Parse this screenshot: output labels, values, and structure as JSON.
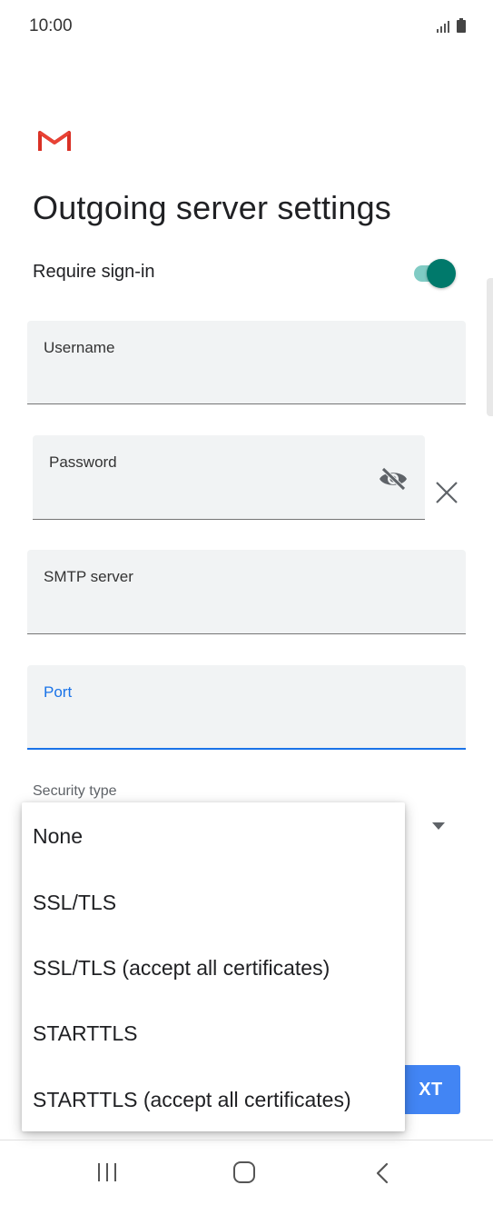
{
  "status_bar": {
    "time": "10:00"
  },
  "header": {
    "logo_icon": "gmail-logo-icon",
    "title": "Outgoing server settings"
  },
  "require_signin": {
    "label": "Require sign-in",
    "enabled": true,
    "color": "#00796b"
  },
  "fields": {
    "username": {
      "label": "Username",
      "value": ""
    },
    "password": {
      "label": "Password",
      "value": "",
      "visibility_icon": "visibility-off-icon",
      "clear_icon": "close-icon"
    },
    "smtp_server": {
      "label": "SMTP server",
      "value": ""
    },
    "port": {
      "label": "Port",
      "value": "",
      "focused": true,
      "accent": "#1a73e8"
    }
  },
  "security_type": {
    "label": "Security type",
    "options": [
      "None",
      "SSL/TLS",
      "SSL/TLS (accept all certificates)",
      "STARTTLS",
      "STARTTLS (accept all certificates)"
    ]
  },
  "next_button": {
    "label": "XT",
    "color": "#4285f4"
  },
  "nav_bar": {
    "recent_icon": "recent-apps-icon",
    "home_icon": "home-icon",
    "back_icon": "back-icon"
  }
}
